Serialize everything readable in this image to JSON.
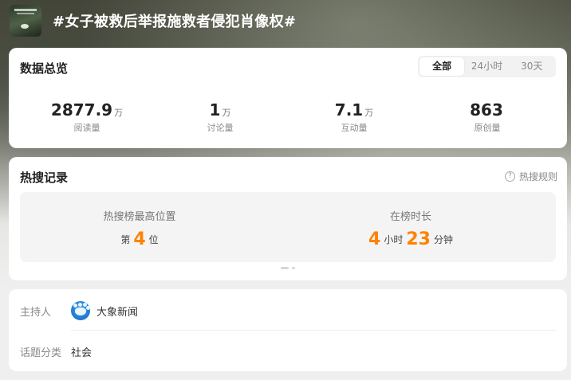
{
  "header": {
    "title": "#女子被救后举报施救者侵犯肖像权#"
  },
  "overview": {
    "title": "数据总览",
    "tabs": [
      {
        "label": "全部",
        "active": true
      },
      {
        "label": "24小时",
        "active": false
      },
      {
        "label": "30天",
        "active": false
      }
    ],
    "stats": [
      {
        "value": "2877.9",
        "unit": "万",
        "label": "阅读量"
      },
      {
        "value": "1",
        "unit": "万",
        "label": "讨论量"
      },
      {
        "value": "7.1",
        "unit": "万",
        "label": "互动量"
      },
      {
        "value": "863",
        "unit": "",
        "label": "原创量"
      }
    ]
  },
  "hot": {
    "title": "热搜记录",
    "rules_label": "热搜规则",
    "best_position": {
      "label": "热搜榜最高位置",
      "prefix": "第",
      "value": "4",
      "suffix": "位"
    },
    "duration": {
      "label": "在榜时长",
      "hours": "4",
      "hours_unit": "小时",
      "minutes": "23",
      "minutes_unit": "分钟"
    }
  },
  "info": {
    "host_key": "主持人",
    "host_name": "大象新闻",
    "category_key": "话题分类",
    "category_value": "社会"
  },
  "colors": {
    "accent": "#ff8200",
    "card_bg": "#ffffff",
    "page_bg": "#efefef"
  }
}
